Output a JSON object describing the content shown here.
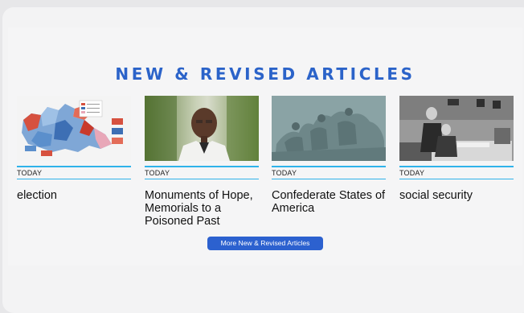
{
  "section": {
    "heading": "NEW & REVISED ARTICLES",
    "more_button": "More New & Revised Articles"
  },
  "articles": [
    {
      "tag": "TODAY",
      "title": "election",
      "image": "canada-election-map-image"
    },
    {
      "tag": "TODAY",
      "title": "Monuments of Hope, Memorials to a Poisoned Past",
      "image": "speaker-portrait-image"
    },
    {
      "tag": "TODAY",
      "title": "Confederate States of America",
      "image": "stone-mountain-carving-image"
    },
    {
      "tag": "TODAY",
      "title": "social security",
      "image": "historic-signing-photo-image"
    }
  ],
  "colors": {
    "accent_heading": "#2b63c9",
    "divider": "#2fb3ea",
    "button_bg": "#2c61cf"
  }
}
